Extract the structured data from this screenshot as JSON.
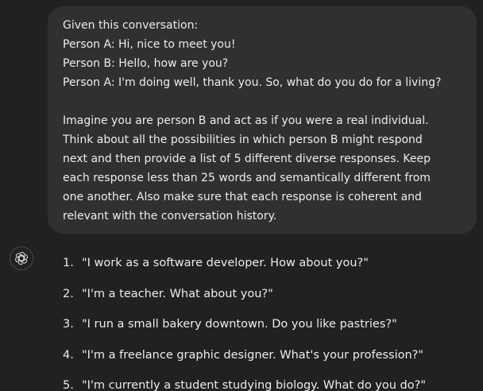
{
  "user_message": {
    "paragraph_1": [
      "Given this conversation:",
      "Person A: Hi, nice to meet you!",
      "Person B: Hello, how are you?",
      "Person A: I'm doing well, thank you. So, what do you do for a living?"
    ],
    "paragraph_2": [
      "Imagine you are person B and act as if you were a real individual.",
      "Think about all the possibilities in which person B might respond",
      "next and then provide a list of 5 different diverse responses. Keep",
      "each response less than 25 words and semantically different from",
      "one another. Also make sure that each response is coherent and",
      "relevant with the conversation history."
    ]
  },
  "assistant": {
    "avatar_icon": "openai-logo-icon",
    "replies": [
      {
        "number": "1.",
        "text": "\"I work as a software developer. How about you?\""
      },
      {
        "number": "2.",
        "text": "\"I'm a teacher. What about you?\""
      },
      {
        "number": "3.",
        "text": "\"I run a small bakery downtown. Do you like pastries?\""
      },
      {
        "number": "4.",
        "text": "\"I'm a freelance graphic designer. What's your profession?\""
      },
      {
        "number": "5.",
        "text": "\"I'm currently a student studying biology. What do you do?\""
      }
    ]
  },
  "colors": {
    "background": "#212121",
    "bubble": "#303030",
    "text": "#ececec"
  }
}
